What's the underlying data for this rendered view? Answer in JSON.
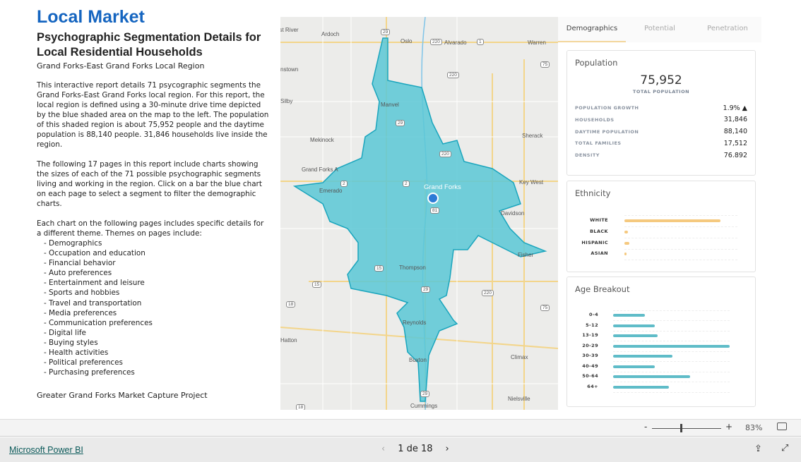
{
  "header": {
    "title": "Local Market",
    "subtitle": "Psychographic Segmentation Details for Local Residential Households",
    "region": "Grand Forks-East Grand Forks Local Region"
  },
  "body": {
    "p1": "This interactive report details 71 psycographic segments the Grand Forks-East Grand Forks local region. For this report, the local region is defined using a 30-minute drive time depicted by the blue shaded area on the map to the left. The population of this shaded region is about 75,952 people and the daytime population is 88,140 people. 31,846 households live inside the region.",
    "p2": "The following 17 pages in this report include charts showing the sizes of each of the 71 possible psychographic segments living and working in the region. Click on a bar the blue chart on each page to select a segment to filter the demographic charts.",
    "p3": "Each chart on the following pages includes specific details for a different theme. Themes on pages include:",
    "themes": [
      "- Demographics",
      "- Occupation and education",
      "- Financial behavior",
      "- Auto preferences",
      "- Entertainment and leisure",
      "- Sports and hobbies",
      "- Travel and transportation",
      "- Media preferences",
      "- Communication preferences",
      "- Digital life",
      "- Buying styles",
      "- Health activities",
      "- Political preferences",
      "- Purchasing preferences"
    ],
    "footer_note": "Greater Grand Forks Market Capture Project"
  },
  "map": {
    "area_color": "#5bc8d6",
    "labels": [
      "est River",
      "Ardoch",
      "Oslo",
      "Alvarado",
      "Warren",
      "nstown",
      "Silby",
      "Manvel",
      "Sherack",
      "Mekinock",
      "Grand Forks A",
      "Emerado",
      "Grand Forks",
      "Key West",
      "Davidson",
      "Fisher",
      "Thompson",
      "Hatton",
      "Reynolds",
      "Buxton",
      "Climax",
      "Cummings",
      "Nielsville"
    ],
    "shields": [
      "29",
      "220",
      "1",
      "75",
      "220",
      "29",
      "220",
      "2",
      "2",
      "81",
      "15",
      "15",
      "29",
      "220",
      "18",
      "75",
      "29",
      "18"
    ]
  },
  "tabs": [
    "Demographics",
    "Potential",
    "Penetration"
  ],
  "population": {
    "title": "Population",
    "total": "75,952",
    "total_label": "TOTAL POPULATION",
    "stats": [
      {
        "k": "POPULATION GROWTH",
        "v": "1.9% ▲"
      },
      {
        "k": "HOUSEHOLDS",
        "v": "31,846"
      },
      {
        "k": "DAYTIME POPULATION",
        "v": "88,140"
      },
      {
        "k": "TOTAL FAMILIES",
        "v": "17,512"
      },
      {
        "k": "DENSITY",
        "v": "76.892"
      }
    ]
  },
  "chart_data": [
    {
      "type": "bar",
      "title": "Ethnicity",
      "categories": [
        "WHITE",
        "BLACK",
        "HISPANIC",
        "ASIAN"
      ],
      "values": [
        0.85,
        0.03,
        0.045,
        0.015
      ],
      "color": "#f5c97f"
    },
    {
      "type": "bar",
      "title": "Age Breakout",
      "categories": [
        "0-4",
        "5-12",
        "13-19",
        "20-29",
        "30-39",
        "40-49",
        "50-64",
        "64+"
      ],
      "values": [
        0.27,
        0.36,
        0.38,
        1.0,
        0.51,
        0.36,
        0.66,
        0.48
      ],
      "color": "#5fbcc8"
    }
  ],
  "zoom": {
    "level": "83%",
    "fraction": 0.42
  },
  "bottom": {
    "brand": "Microsoft Power BI",
    "page": "1 de 18"
  }
}
